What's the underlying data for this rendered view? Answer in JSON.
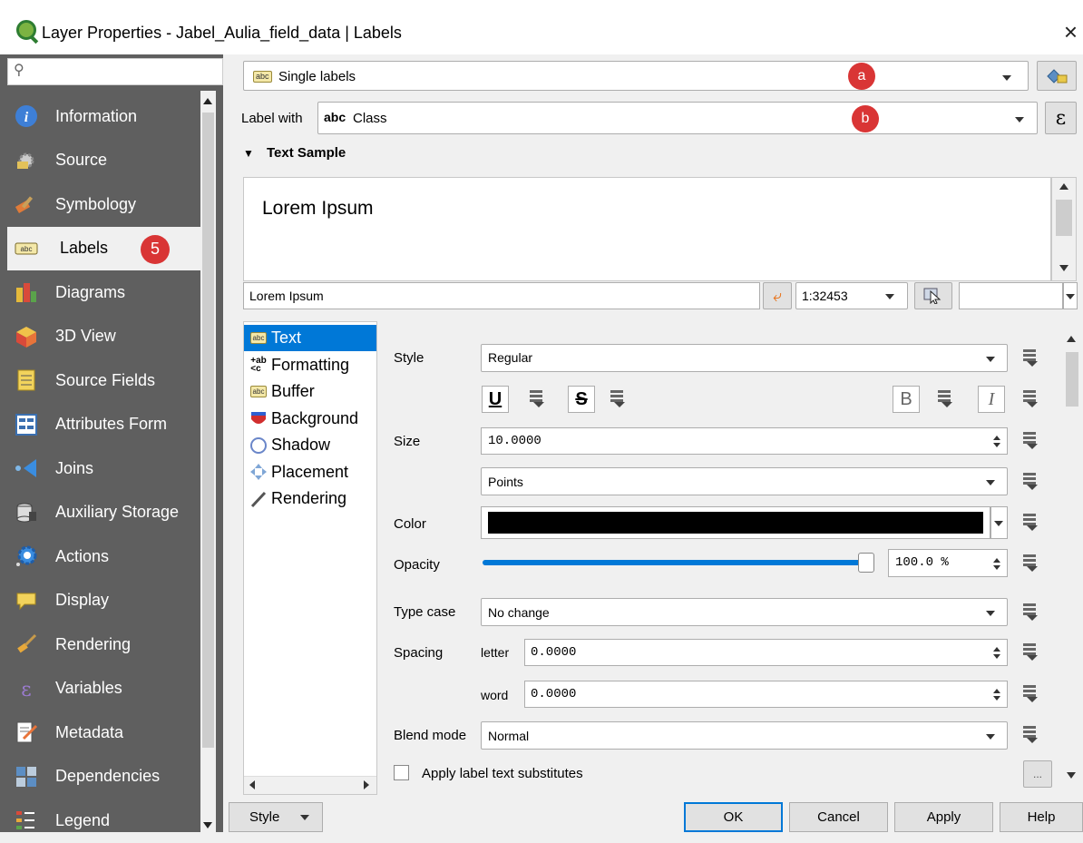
{
  "window": {
    "title": "Layer Properties - Jabel_Aulia_field_data | Labels",
    "close": "×"
  },
  "sidebar": {
    "search_icon": "search-icon",
    "items": [
      {
        "label": "Information",
        "icon": "info-icon"
      },
      {
        "label": "Source",
        "icon": "source-icon"
      },
      {
        "label": "Symbology",
        "icon": "symbology-icon"
      },
      {
        "label": "Labels",
        "icon": "labels-icon",
        "selected": true,
        "badge": "5"
      },
      {
        "label": "Diagrams",
        "icon": "diagrams-icon"
      },
      {
        "label": "3D View",
        "icon": "3d-view-icon"
      },
      {
        "label": "Source Fields",
        "icon": "source-fields-icon"
      },
      {
        "label": "Attributes Form",
        "icon": "attributes-form-icon"
      },
      {
        "label": "Joins",
        "icon": "joins-icon"
      },
      {
        "label": "Auxiliary Storage",
        "icon": "auxiliary-storage-icon"
      },
      {
        "label": "Actions",
        "icon": "actions-icon"
      },
      {
        "label": "Display",
        "icon": "display-icon"
      },
      {
        "label": "Rendering",
        "icon": "rendering-icon"
      },
      {
        "label": "Variables",
        "icon": "variables-icon"
      },
      {
        "label": "Metadata",
        "icon": "metadata-icon"
      },
      {
        "label": "Dependencies",
        "icon": "dependencies-icon"
      },
      {
        "label": "Legend",
        "icon": "legend-icon"
      }
    ]
  },
  "label_mode": {
    "value": "Single labels",
    "badge": "a"
  },
  "label_with": {
    "label": "Label with",
    "type_tag": "abc",
    "value": "Class",
    "badge": "b",
    "expr": "ε"
  },
  "text_sample": {
    "header": "Text Sample",
    "preview_text": "Lorem Ipsum",
    "input_value": "Lorem Ipsum",
    "scale": "1:32453"
  },
  "tree": {
    "items": [
      {
        "label": "Text",
        "icon": "abc"
      },
      {
        "label": "Formatting",
        "icon": "+ab"
      },
      {
        "label": "Buffer",
        "icon": "abc"
      },
      {
        "label": "Background",
        "icon": "background-icon"
      },
      {
        "label": "Shadow",
        "icon": "shadow-icon"
      },
      {
        "label": "Placement",
        "icon": "placement-icon"
      },
      {
        "label": "Rendering",
        "icon": "rendering-icon"
      }
    ]
  },
  "text": {
    "style_label": "Style",
    "style_value": "Regular",
    "underline": "U",
    "strike": "S",
    "bold": "B",
    "italic": "I",
    "size_label": "Size",
    "size_value": "10.0000",
    "unit_value": "Points",
    "color_label": "Color",
    "color_value": "#000000",
    "opacity_label": "Opacity",
    "opacity_value": "100.0 %",
    "opacity_fraction": 1.0,
    "typecase_label": "Type case",
    "typecase_value": "No change",
    "spacing_label": "Spacing",
    "letter_label": "letter",
    "letter_value": "0.0000",
    "word_label": "word",
    "word_value": "0.0000",
    "blend_label": "Blend mode",
    "blend_value": "Normal",
    "substitutes_label": "Apply label text substitutes",
    "substitutes_button": "..."
  },
  "buttons": {
    "style": "Style",
    "ok": "OK",
    "cancel": "Cancel",
    "apply": "Apply",
    "help": "Help"
  },
  "colors": {
    "accent": "#0078d7",
    "sidebar": "#5f5f5f",
    "badge": "#d93535"
  }
}
